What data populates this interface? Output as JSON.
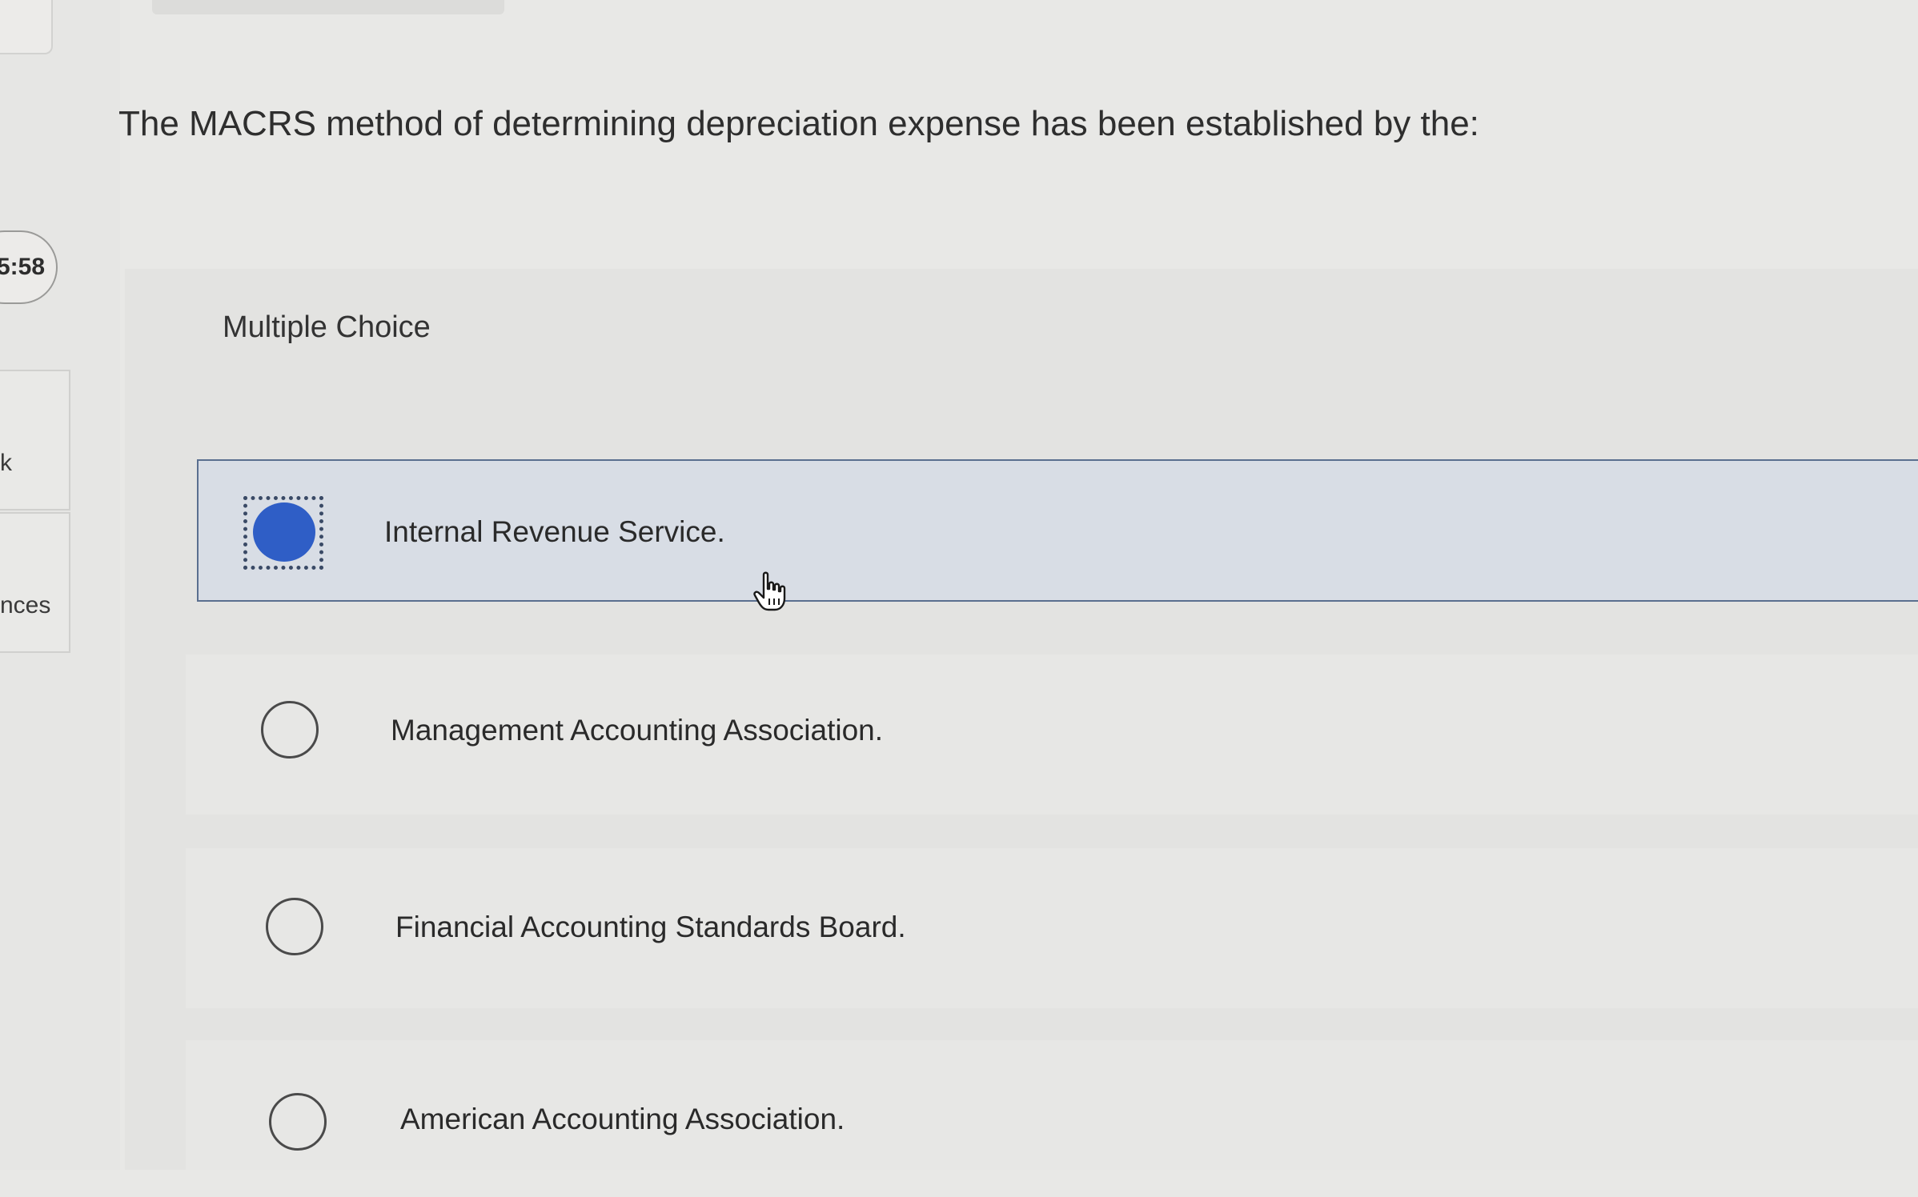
{
  "sidebar": {
    "timer": "5:58",
    "item_1_label": "k",
    "item_2_label": "nces"
  },
  "question": {
    "text": "The MACRS method of determining depreciation expense has been established by the:"
  },
  "question_type": "Multiple Choice",
  "options": [
    {
      "label": "Internal Revenue Service.",
      "selected": true
    },
    {
      "label": "Management Accounting Association.",
      "selected": false
    },
    {
      "label": "Financial Accounting Standards Board.",
      "selected": false
    },
    {
      "label": "American Accounting Association.",
      "selected": false
    }
  ],
  "colors": {
    "selected_fill": "#2f5ec6",
    "selected_background": "#d8dde5",
    "selected_border": "#5a6f8f"
  },
  "icons": {
    "cursor": "hand-pointer-icon"
  }
}
